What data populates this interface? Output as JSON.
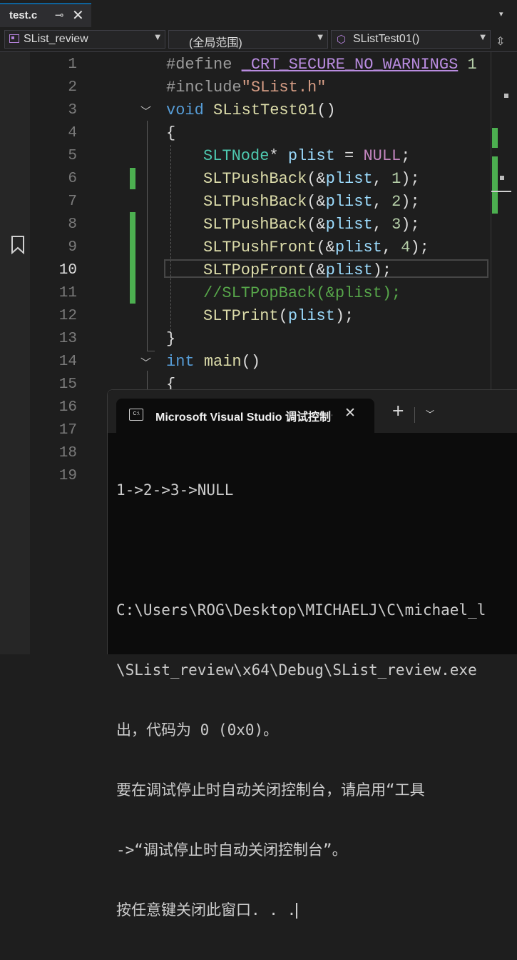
{
  "tab": {
    "filename": "test.c",
    "pin_glyph": "⊸",
    "close_glyph": "✕",
    "overflow_glyph": "▾"
  },
  "nav": {
    "project": "SList_review",
    "scope": "(全局范围)",
    "member": "SListTest01()"
  },
  "editor": {
    "line_numbers": [
      "1",
      "2",
      "3",
      "4",
      "5",
      "6",
      "7",
      "8",
      "9",
      "10",
      "11",
      "12",
      "13",
      "14",
      "15",
      "16",
      "17",
      "18",
      "19"
    ],
    "current_line": "10",
    "code": {
      "l1_kw": "#define",
      "l1_mac": "_CRT_SECURE_NO_WARNINGS",
      "l1_num": "1",
      "l2_kw": "#include",
      "l2_str": "\"SList.h\"",
      "l3_kw": "void",
      "l3_fn": "SListTest01",
      "l3_rest": "()",
      "l4": "{",
      "l5_ty": "SLTNode",
      "l5_p": "*",
      "l5_var": "plist",
      "l5_eq": " = ",
      "l5_null": "NULL",
      "l5_end": ";",
      "l6_fn": "SLTPushBack",
      "l6_a": "(&",
      "l6_var": "plist",
      "l6_b": ", ",
      "l6_num": "1",
      "l6_c": ");",
      "l7_fn": "SLTPushBack",
      "l7_a": "(&",
      "l7_var": "plist",
      "l7_b": ", ",
      "l7_num": "2",
      "l7_c": ");",
      "l8_fn": "SLTPushBack",
      "l8_a": "(&",
      "l8_var": "plist",
      "l8_b": ", ",
      "l8_num": "3",
      "l8_c": ");",
      "l9_fn": "SLTPushFront",
      "l9_a": "(&",
      "l9_var": "plist",
      "l9_b": ", ",
      "l9_num": "4",
      "l9_c": ");",
      "l10_fn": "SLTPopFront",
      "l10_a": "(&",
      "l10_var": "plist",
      "l10_c": ");",
      "l11_cm": "//SLTPopBack(&plist);",
      "l12_fn": "SLTPrint",
      "l12_a": "(",
      "l12_var": "plist",
      "l12_c": ");",
      "l13": "}",
      "l14_kw": "int",
      "l14_fn": "main",
      "l14_rest": "()",
      "l15": "{"
    }
  },
  "console": {
    "title": "Microsoft Visual Studio 调试控制台",
    "icon_text": "C:\\",
    "output_lines": [
      "1->2->3->NULL",
      "",
      "C:\\Users\\ROG\\Desktop\\MICHAELJ\\C\\michael_l",
      "\\SList_review\\x64\\Debug\\SList_review.exe",
      "出，代码为 0 (0x0)。",
      "要在调试停止时自动关闭控制台，请启用“工具",
      "->“调试停止时自动关闭控制台”。",
      "按任意键关闭此窗口. . ."
    ]
  },
  "colors": {
    "keyword": "#569cd6",
    "macro": "#b98ce0",
    "string": "#d69d85",
    "function": "#dcdcaa",
    "type": "#4ec9b0",
    "variable": "#9cdcfe",
    "comment": "#57a64a",
    "change_marker": "#4caf50"
  }
}
